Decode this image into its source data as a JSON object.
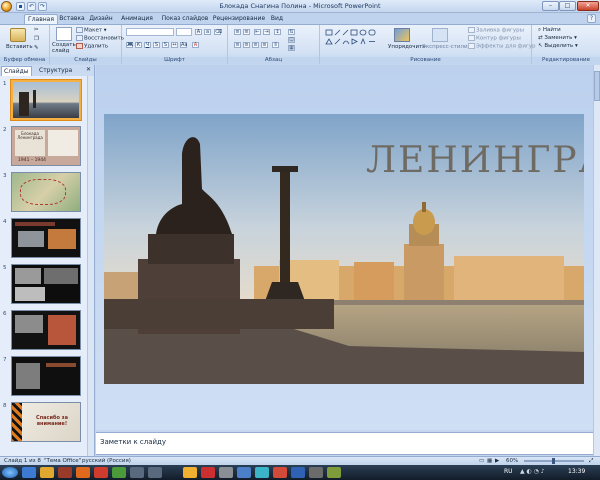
{
  "window": {
    "title": "Блокада Снагина Полина - Microsoft PowerPoint"
  },
  "ribbon_tabs": [
    "Главная",
    "Вставка",
    "Дизайн",
    "Анимация",
    "Показ слайдов",
    "Рецензирование",
    "Вид"
  ],
  "ribbon": {
    "paste": "Вставить",
    "new_slide": "Создать слайд",
    "layout": "Макет",
    "reset": "Восстановить",
    "delete": "Удалить",
    "arrange": "Упорядочить",
    "quick_styles": "Экспресс-стили",
    "shape_fill": "Заливка фигуры",
    "shape_outline": "Контур фигуры",
    "shape_effects": "Эффекты для фигур",
    "find": "Найти",
    "replace": "Заменить",
    "select": "Выделить",
    "groups": {
      "clipboard": "Буфер обмена",
      "slides": "Слайды",
      "font": "Шрифт",
      "paragraph": "Абзац",
      "drawing": "Рисование",
      "editing": "Редактирование"
    }
  },
  "pane_tabs": [
    "Слайды",
    "Структура"
  ],
  "thumbnails": [
    {
      "num": "1",
      "selected": true
    },
    {
      "num": "2",
      "title": "Блокада Ленинграда",
      "years": "1941 – 1944"
    },
    {
      "num": "3"
    },
    {
      "num": "4"
    },
    {
      "num": "5"
    },
    {
      "num": "6"
    },
    {
      "num": "7"
    },
    {
      "num": "8",
      "text": "Спасибо за внимание!"
    }
  ],
  "slide": {
    "title": "ЛЕНИНГРАД"
  },
  "notes_placeholder": "Заметки к слайду",
  "status": {
    "slide": "Слайд 1 из 8",
    "theme": "\"Тема Office\"",
    "language": "русский (Россия)",
    "zoom": "60%"
  },
  "taskbar": {
    "lang": "RU",
    "time": "13:39"
  }
}
